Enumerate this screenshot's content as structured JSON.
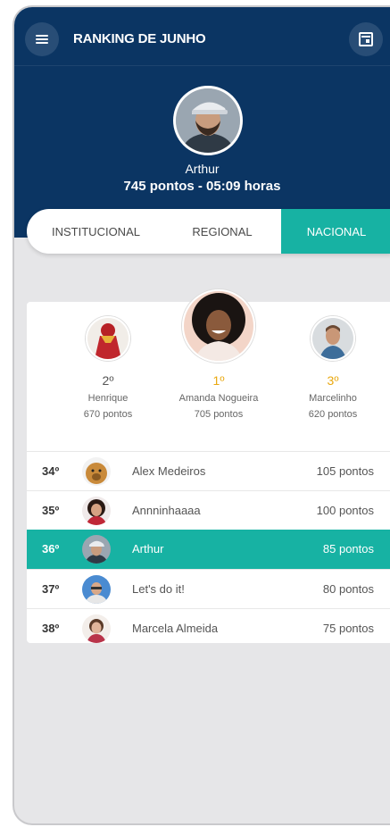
{
  "header": {
    "title": "RANKING DE JUNHO",
    "user_name": "Arthur",
    "user_stats": "745 pontos - 05:09 horas",
    "menu_icon": "menu-icon",
    "calendar_icon": "calendar-icon"
  },
  "tabs": [
    {
      "label": "INSTITUCIONAL"
    },
    {
      "label": "REGIONAL"
    },
    {
      "label": "NACIONAL"
    }
  ],
  "podium": {
    "first": {
      "position": "1º",
      "name": "Amanda Nogueira",
      "points": "705 pontos"
    },
    "second": {
      "position": "2º",
      "name": "Henrique",
      "points": "670 pontos"
    },
    "third": {
      "position": "3º",
      "name": "Marcelinho",
      "points": "620 pontos"
    }
  },
  "ranking": [
    {
      "position": "34º",
      "name": "Alex Medeiros",
      "points": "105 pontos"
    },
    {
      "position": "35º",
      "name": "Annninhaaaa",
      "points": "100 pontos"
    },
    {
      "position": "36º",
      "name": "Arthur",
      "points": "85 pontos"
    },
    {
      "position": "37º",
      "name": "Let's do it!",
      "points": "80 pontos"
    },
    {
      "position": "38º",
      "name": "Marcela Almeida",
      "points": "75 pontos"
    }
  ],
  "colors": {
    "header_bg": "#0b3563",
    "accent": "#17b2a3",
    "gold": "#e9a80f"
  }
}
